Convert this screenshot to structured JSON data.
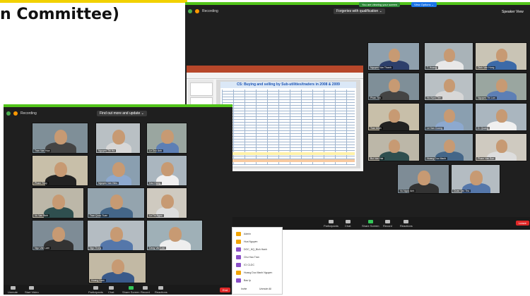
{
  "header": {
    "title_fragment": "n Committee)"
  },
  "right_window": {
    "topbar_left_label": "Recording",
    "speaker_label": "Forgeries with qualification ⌄",
    "top_right_label": "Speaker View",
    "pill_green": "You are viewing your screen",
    "pill_blue": "View Options ⌄",
    "shared_doc_title": "CS: Buying and selling by Sub-utilities/traders in 2008 & 2009",
    "controls": [
      "Unmute",
      "Start Video",
      "Participants",
      "Chat",
      "Share Screen",
      "Record",
      "Reactions"
    ],
    "end_label": "Leave",
    "participants": [
      "Nguyen Van Thanh",
      "T. Hoang",
      "Dinh Van Hung",
      "Phan Ton",
      "Ho Nam Tien",
      "Nguyen Thi Lan",
      "Tran Minh",
      "Le Van Cuong",
      "D. Quang",
      "Bui Van Hai",
      "Hoang Duc Manh",
      "Pham Van Son",
      "Vu Ngoc Anh",
      "Doan Van Thu",
      "Truong Quang Tuan",
      "Nguyen Van Duc",
      "Lai Thi Minh"
    ]
  },
  "left_window": {
    "topbar_left_label": "Recording",
    "speaker_label": "Find out more and update ⌄",
    "controls": [
      "Unmute",
      "Start Video",
      "Participants",
      "Chat",
      "Share Screen",
      "Record",
      "Reactions"
    ],
    "end_label": "End",
    "participants": [
      "Tran Van Hoa",
      "Nguyen Thi Ha",
      "Le Duc Anh",
      "Pham Thuy",
      "Nguyen Van Hieu",
      "Dao Hung",
      "Vu Van Binh",
      "Tran Quoc Tuan",
      "Le Thi Ngoc",
      "Ngo Van Lam",
      "Ngo Trung",
      "Dang Van Loc",
      "Hoang Nam",
      "Phan Van Khai",
      "Bui Thanh",
      "Vu Duc Nam"
    ]
  },
  "participant_panel": {
    "items": [
      "Admin",
      "Hoa Nguyen",
      "DOC_HQ_Bich Hanh",
      "Chu Hau Tran",
      "ICI CLDC",
      "Hoang Duc Manh Nguyen",
      "Bao Ip"
    ],
    "footer": [
      "Invite",
      "Unmute All"
    ]
  }
}
